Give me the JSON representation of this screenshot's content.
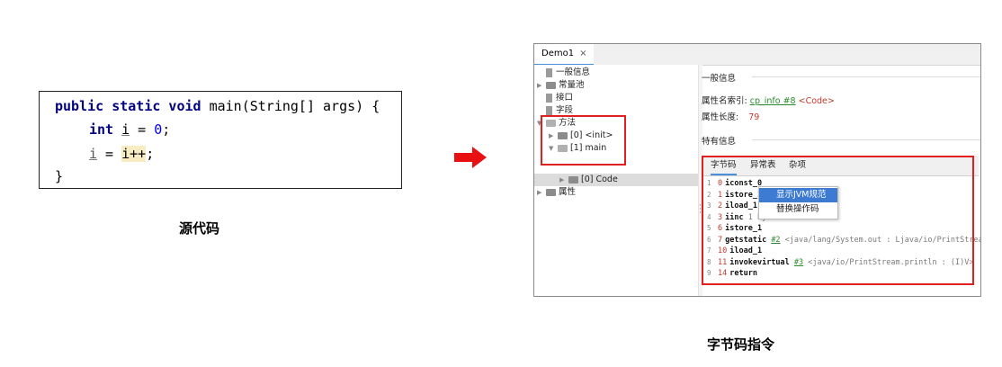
{
  "source_code": {
    "line1": {
      "kw": "public static void",
      "rest": " main(String[] args) {"
    },
    "line2": {
      "kw": "int",
      "var": "i",
      "eq": " = ",
      "num": "0",
      "end": ";"
    },
    "line3": {
      "var": "i",
      "eq": " = ",
      "expr": "i++",
      "end": ";"
    },
    "line4": "}",
    "caption": "源代码"
  },
  "window": {
    "tab_title": "Demo1",
    "tab_close": "×",
    "tree": [
      {
        "label": "一般信息"
      },
      {
        "label": "常量池"
      },
      {
        "label": "接口"
      },
      {
        "label": "字段"
      },
      {
        "label": "方法"
      },
      {
        "label": "[0] <init>"
      },
      {
        "label": "[1] main"
      },
      {
        "label": "[0] Code"
      },
      {
        "label": "属性"
      }
    ],
    "general": {
      "heading": "一般信息",
      "name_index_label": "属性名索引:",
      "name_index_link": "cp_info #8",
      "name_index_value": "<Code>",
      "length_label": "属性长度:",
      "length_value": "79",
      "specific_heading": "特有信息"
    },
    "subtabs": [
      "字节码",
      "异常表",
      "杂项"
    ],
    "bytecode": [
      {
        "ln": "1",
        "off": "0",
        "op": "iconst_0",
        "ref": "",
        "arg": ""
      },
      {
        "ln": "2",
        "off": "1",
        "op": "istore_1",
        "ref": "",
        "arg": ""
      },
      {
        "ln": "3",
        "off": "2",
        "op": "iload_1",
        "ref": "",
        "arg": ""
      },
      {
        "ln": "4",
        "off": "3",
        "op": "iinc",
        "ref": "",
        "arg": "1 by 1"
      },
      {
        "ln": "5",
        "off": "6",
        "op": "istore_1",
        "ref": "",
        "arg": ""
      },
      {
        "ln": "6",
        "off": "7",
        "op": "getstatic",
        "ref": "#2",
        "arg": "<java/lang/System.out : Ljava/io/PrintStream;>"
      },
      {
        "ln": "7",
        "off": "10",
        "op": "iload_1",
        "ref": "",
        "arg": ""
      },
      {
        "ln": "8",
        "off": "11",
        "op": "invokevirtual",
        "ref": "#3",
        "arg": "<java/io/PrintStream.println : (I)V>"
      },
      {
        "ln": "9",
        "off": "14",
        "op": "return",
        "ref": "",
        "arg": ""
      }
    ],
    "context_menu": [
      "显示JVM规范",
      "替换操作码"
    ]
  },
  "bytecode_caption": "字节码指令",
  "colors": {
    "highlight_box": "#e02020",
    "arrow": "#e81010",
    "selection": "#3d7bd2"
  }
}
